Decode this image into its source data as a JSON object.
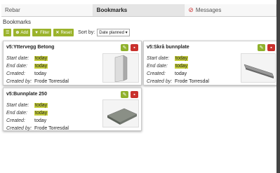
{
  "tabs": [
    {
      "label": "Rebar",
      "active": false,
      "icon": ""
    },
    {
      "label": "Bookmarks",
      "active": true,
      "icon": ""
    },
    {
      "label": "Messages",
      "active": false,
      "icon": "circle-slash-icon"
    }
  ],
  "section_title": "Bookmarks",
  "toolbar": {
    "list_icon": "list-icon",
    "add_label": "Add",
    "filter_label": "Filter",
    "reset_label": "Reset",
    "sort_label": "Sort by:",
    "sort_value": "Date planned"
  },
  "cards": [
    {
      "name": "v5:Yttervegg Betong",
      "start_label": "Start date:",
      "start": "today",
      "end_label": "End date:",
      "end": "today",
      "created_label": "Created:",
      "created": "today",
      "by_label": "Created by:",
      "by": "Frode Torresdal"
    },
    {
      "name": "v5:Skrå bunnplate",
      "start_label": "Start date:",
      "start": "today",
      "end_label": "End date:",
      "end": "today",
      "created_label": "Created:",
      "created": "today",
      "by_label": "Created by:",
      "by": "Frode Torresdal"
    },
    {
      "name": "v5:Bunnplate 250",
      "start_label": "Start date:",
      "start": "today",
      "end_label": "End date:",
      "end": "today",
      "created_label": "Created:",
      "created": "today",
      "by_label": "Created by:",
      "by": "Frode Torresdal"
    }
  ],
  "colors": {
    "accent_green": "#9bb32c",
    "highlight": "#c8d13a",
    "delete_red": "#c9302c"
  }
}
